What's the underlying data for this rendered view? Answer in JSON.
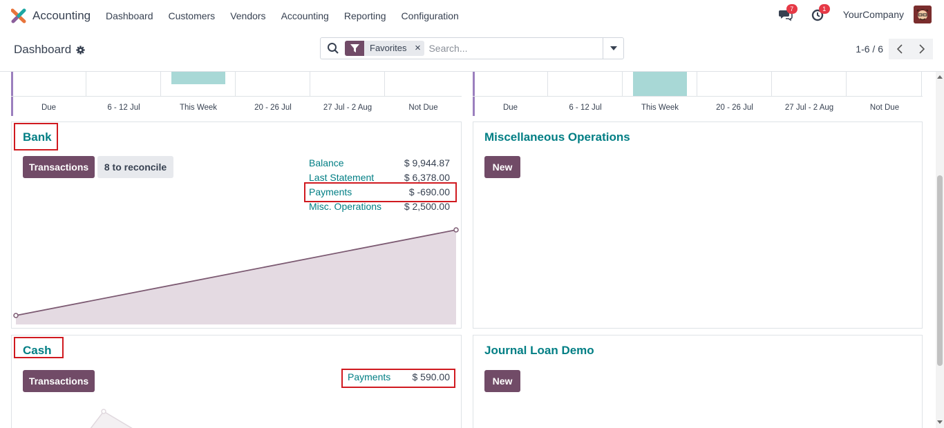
{
  "app": {
    "name": "Accounting",
    "menu": [
      "Dashboard",
      "Customers",
      "Vendors",
      "Accounting",
      "Reporting",
      "Configuration"
    ],
    "messages_count": "7",
    "activities_count": "1",
    "company": "YourCompany"
  },
  "control_panel": {
    "title": "Dashboard",
    "facet": "Favorites",
    "search_placeholder": "Search...",
    "pager": "1-6 / 6"
  },
  "top_charts": {
    "labels": [
      "Due",
      "6 - 12 Jul",
      "This Week",
      "20 - 26 Jul",
      "27 Jul - 2 Aug",
      "Not Due"
    ]
  },
  "cards": {
    "bank": {
      "title": "Bank",
      "transactions_label": "Transactions",
      "reconcile_label": "8 to reconcile",
      "stats": [
        {
          "label": "Balance",
          "value": "$ 9,944.87"
        },
        {
          "label": "Last Statement",
          "value": "$ 6,378.00"
        },
        {
          "label": "Payments",
          "value": "$ -690.00"
        },
        {
          "label": "Misc. Operations",
          "value": "$ 2,500.00"
        }
      ]
    },
    "misc": {
      "title": "Miscellaneous Operations",
      "new_label": "New"
    },
    "cash": {
      "title": "Cash",
      "transactions_label": "Transactions",
      "stats": [
        {
          "label": "Payments",
          "value": "$ 590.00"
        }
      ]
    },
    "loan": {
      "title": "Journal Loan Demo",
      "new_label": "New"
    }
  },
  "colors": {
    "brand": "#714b67",
    "link": "#017e84",
    "highlight": "#d0191f",
    "bar": "#a8d8d6"
  }
}
